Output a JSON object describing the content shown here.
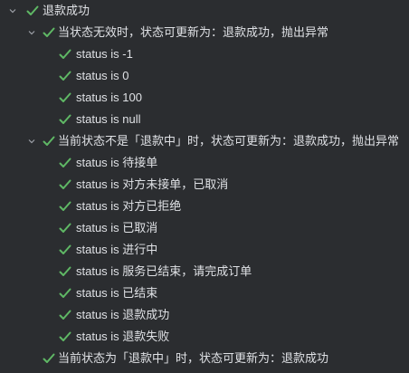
{
  "colors": {
    "background": "#2b2d30",
    "pass": "#5fb865",
    "text": "#dfe1e5"
  },
  "icons": {
    "expand": "chevron-down-icon",
    "passed": "check-icon"
  },
  "tree": [
    {
      "level": 0,
      "expanded": true,
      "label": "退款成功"
    },
    {
      "level": 1,
      "expanded": true,
      "label": "当状态无效时，状态可更新为：退款成功，抛出异常"
    },
    {
      "level": 2,
      "label": "status is -1"
    },
    {
      "level": 2,
      "label": "status is 0"
    },
    {
      "level": 2,
      "label": "status is 100"
    },
    {
      "level": 2,
      "label": "status is null"
    },
    {
      "level": 1,
      "expanded": true,
      "label": "当前状态不是「退款中」时，状态可更新为：退款成功，抛出异常"
    },
    {
      "level": 2,
      "label": "status is 待接单"
    },
    {
      "level": 2,
      "label": "status is 对方未接单，已取消"
    },
    {
      "level": 2,
      "label": "status is 对方已拒绝"
    },
    {
      "level": 2,
      "label": "status is 已取消"
    },
    {
      "level": 2,
      "label": "status is 进行中"
    },
    {
      "level": 2,
      "label": "status is 服务已结束，请完成订单"
    },
    {
      "level": 2,
      "label": "status is 已结束"
    },
    {
      "level": 2,
      "label": "status is 退款成功"
    },
    {
      "level": 2,
      "label": "status is 退款失败"
    },
    {
      "level": 1,
      "expanded": false,
      "label": "当前状态为「退款中」时，状态可更新为：退款成功"
    }
  ]
}
